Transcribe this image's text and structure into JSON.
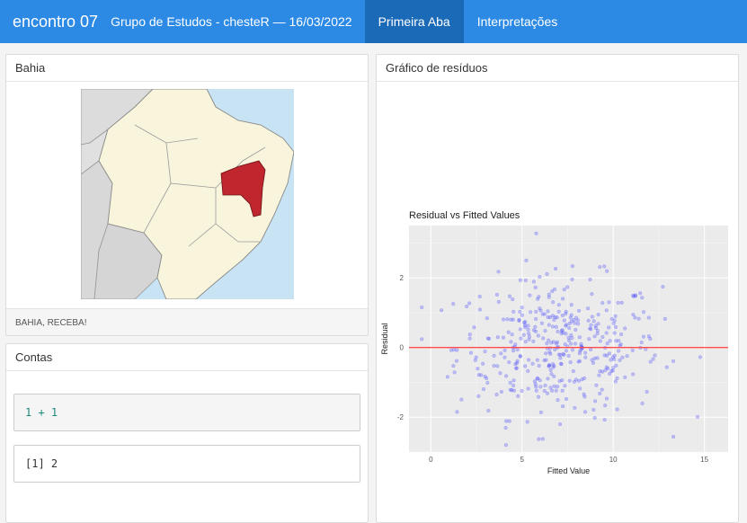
{
  "navbar": {
    "brand": "encontro 07",
    "subtitle": "Grupo de Estudos - chesteR — 16/03/2022",
    "tabs": [
      {
        "label": "Primeira Aba",
        "active": true
      },
      {
        "label": "Interpretações",
        "active": false
      }
    ]
  },
  "bahia_card": {
    "title": "Bahia",
    "footer": "BAHIA, RECEBA!",
    "highlight_color": "#c0262e"
  },
  "contas_card": {
    "title": "Contas",
    "code_input": "1 + 1",
    "code_output": "[1] 2"
  },
  "residuos_card": {
    "title": "Gráfico de resíduos"
  },
  "chart_data": {
    "type": "scatter",
    "title": "Residual vs Fitted Values",
    "xlabel": "Fitted Value",
    "ylabel": "Residual",
    "xlim": [
      -1.2,
      16.3
    ],
    "ylim": [
      -3.0,
      3.5
    ],
    "xticks": [
      0,
      5,
      10,
      15
    ],
    "yticks": [
      -2,
      0,
      2
    ],
    "hline": {
      "y": 0,
      "color": "#ff4b4b"
    },
    "point_color": "#4040ff",
    "grid": true,
    "n_points": 400
  }
}
